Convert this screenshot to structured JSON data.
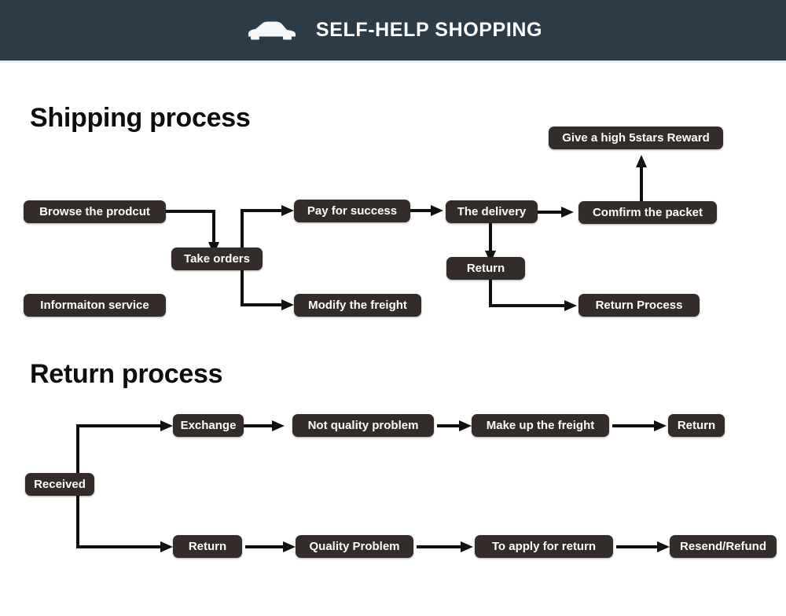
{
  "header": {
    "title": "SELF-HELP SHOPPING",
    "icon": "car-icon",
    "background_color": "#2b3b47",
    "text_color": "#ffffff"
  },
  "theme": {
    "node_color": "#332c28",
    "node_text_color": "#ffffff",
    "connector_color": "#111111",
    "page_background": "#ffffff"
  },
  "sections": [
    {
      "id": "shipping",
      "title": "Shipping process",
      "nodes": [
        {
          "id": "browse",
          "label": "Browse the prodcut"
        },
        {
          "id": "info",
          "label": "Informaiton service"
        },
        {
          "id": "take",
          "label": "Take orders"
        },
        {
          "id": "pay",
          "label": "Pay for success"
        },
        {
          "id": "modify",
          "label": "Modify the freight"
        },
        {
          "id": "delivery",
          "label": "The delivery"
        },
        {
          "id": "return",
          "label": "Return"
        },
        {
          "id": "confirm",
          "label": "Comfirm the packet"
        },
        {
          "id": "reward",
          "label": "Give a high 5stars Reward"
        },
        {
          "id": "retproc",
          "label": "Return Process"
        }
      ]
    },
    {
      "id": "returns",
      "title": "Return process",
      "nodes": [
        {
          "id": "received",
          "label": "Received"
        },
        {
          "id": "exchange",
          "label": "Exchange"
        },
        {
          "id": "notquality",
          "label": "Not quality problem"
        },
        {
          "id": "makeup",
          "label": "Make up the freight"
        },
        {
          "id": "return2",
          "label": "Return"
        },
        {
          "id": "return3",
          "label": "Return"
        },
        {
          "id": "quality",
          "label": "Quality Problem"
        },
        {
          "id": "apply",
          "label": "To apply for return"
        },
        {
          "id": "resend",
          "label": "Resend/Refund"
        }
      ]
    }
  ]
}
